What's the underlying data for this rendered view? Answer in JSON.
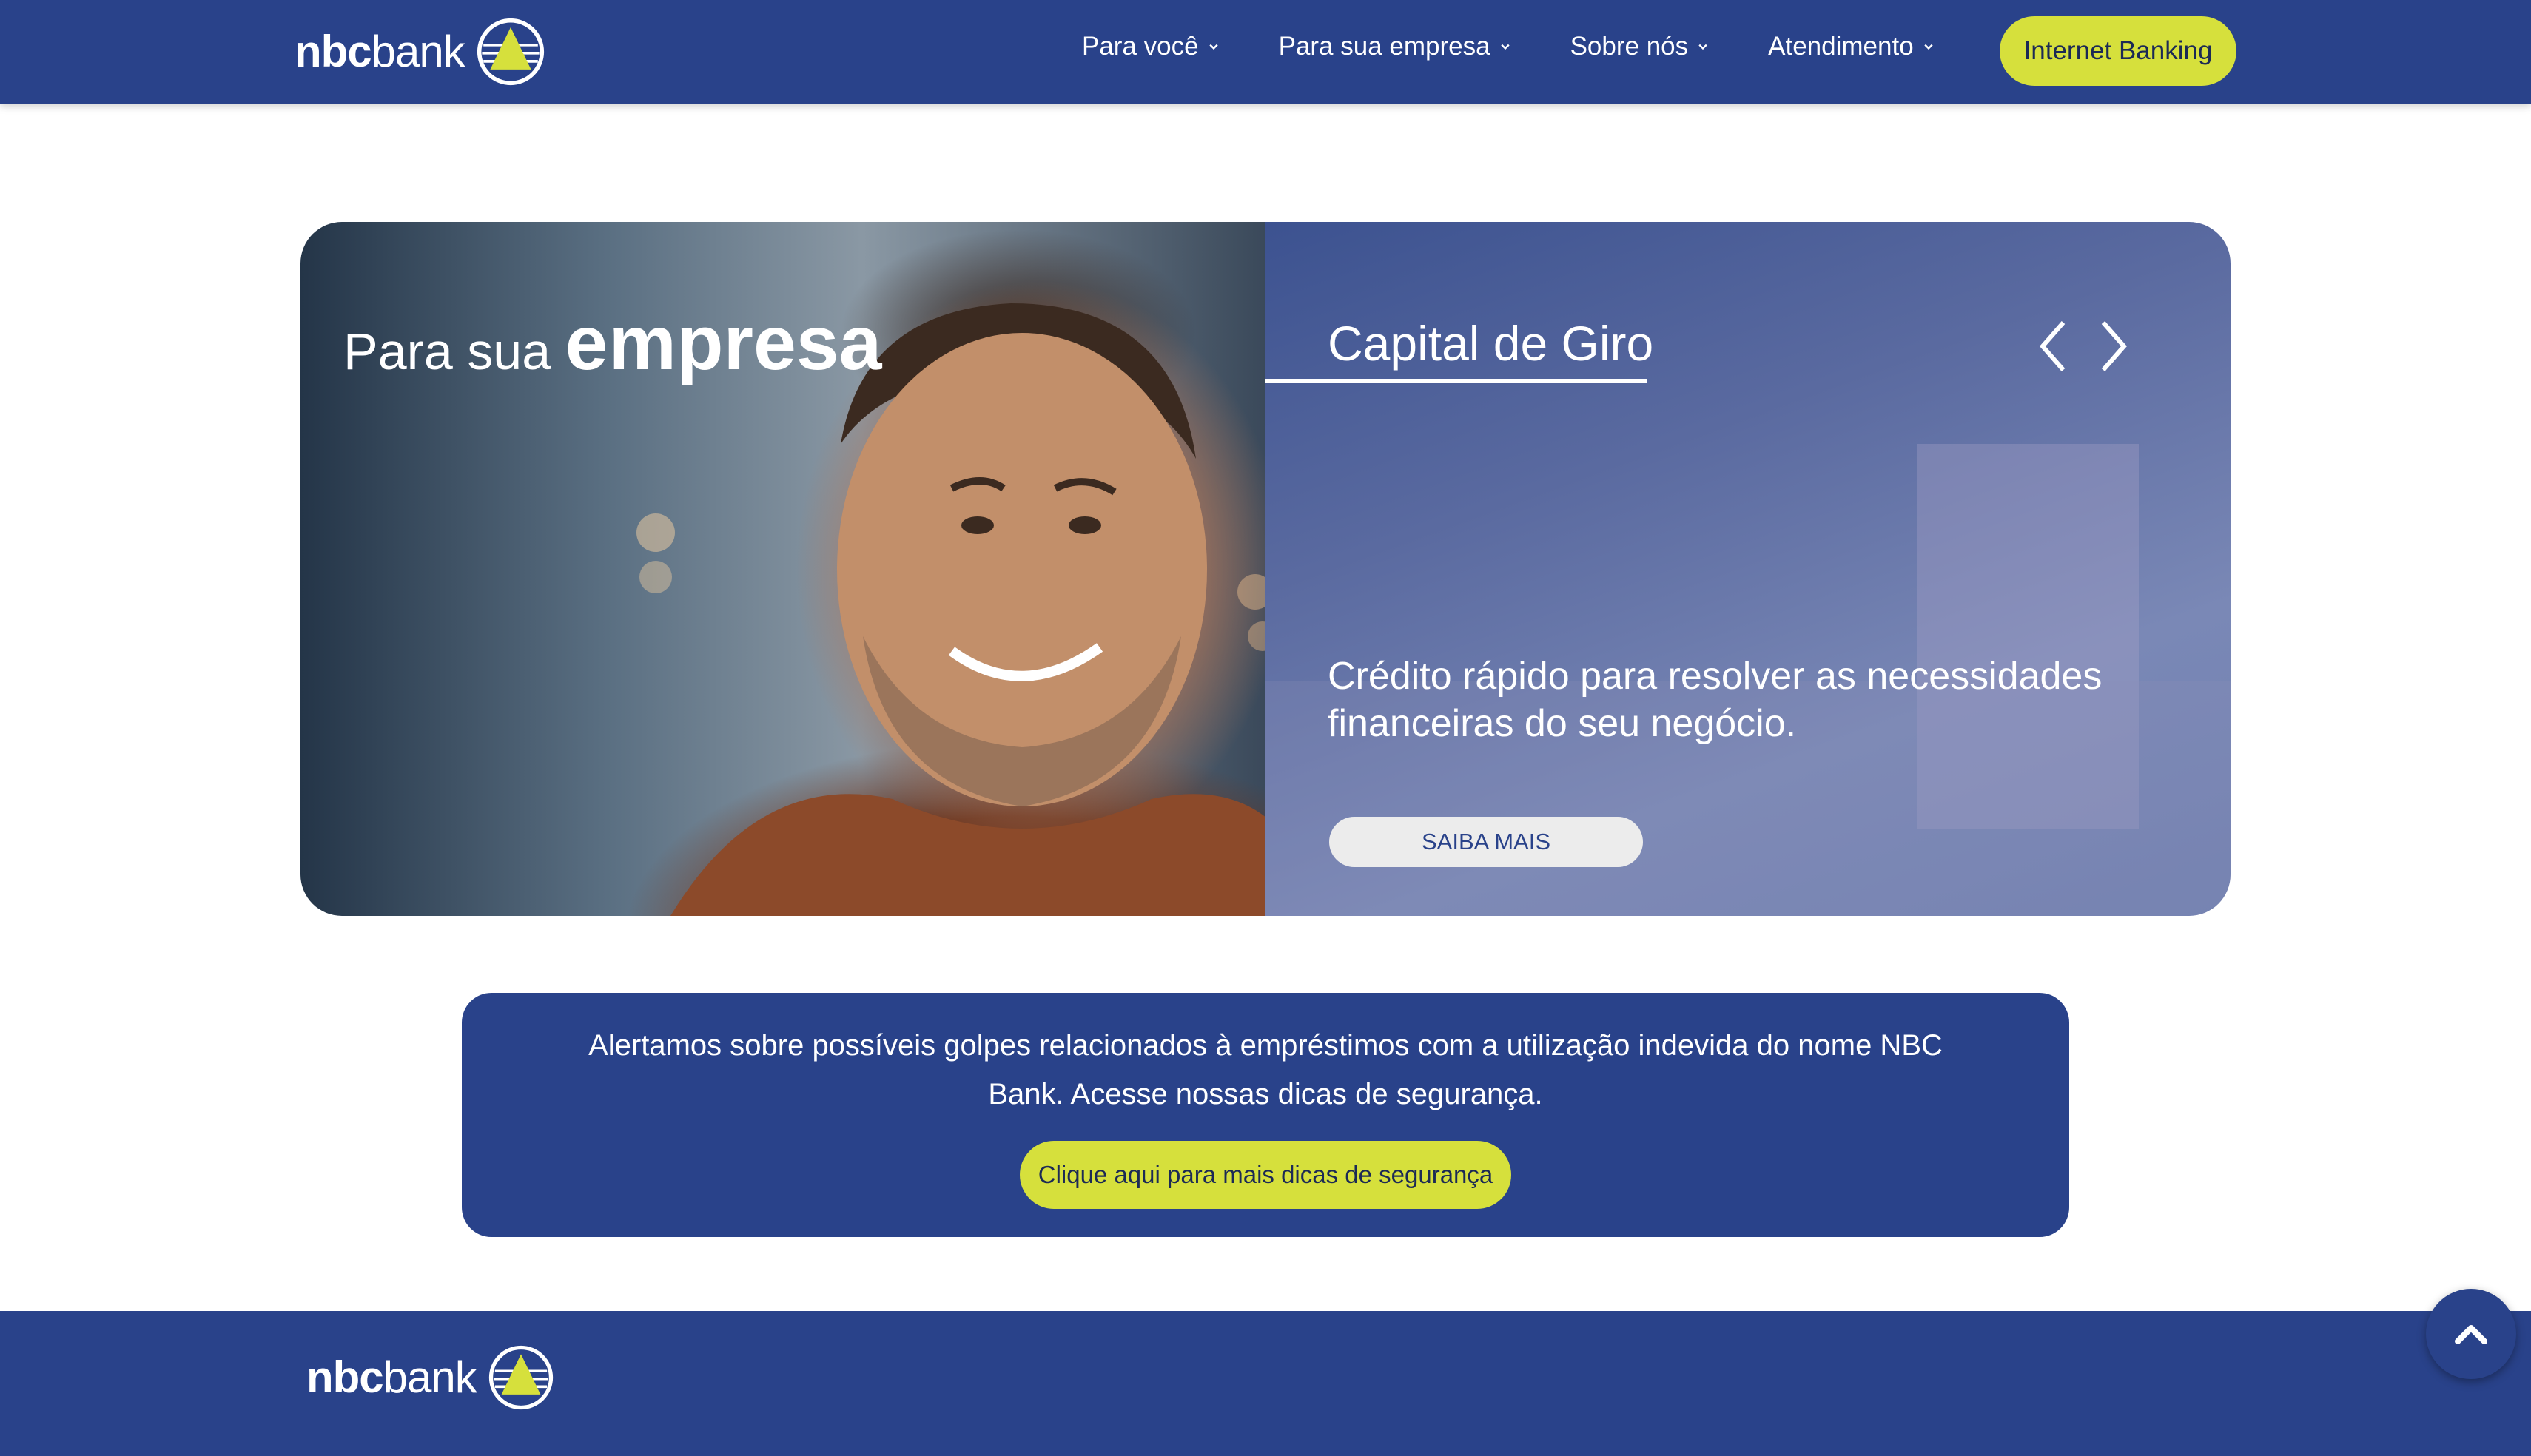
{
  "brand": {
    "logo_bold": "nbc",
    "logo_light": "bank",
    "emblem_icon": "nbc-triangle-emblem-icon"
  },
  "nav": {
    "items": [
      {
        "label": "Para você",
        "icon": "chevron-down-icon"
      },
      {
        "label": "Para sua empresa",
        "icon": "chevron-down-icon"
      },
      {
        "label": "Sobre nós",
        "icon": "chevron-down-icon"
      },
      {
        "label": "Atendimento",
        "icon": "chevron-down-icon"
      }
    ],
    "cta_label": "Internet Banking"
  },
  "hero": {
    "photo_title_prefix": "Para sua",
    "photo_title_emphasis": "empresa",
    "slide_title": "Capital de Giro",
    "slide_text": "Crédito rápido para resolver as necessidades financeiras do seu negócio.",
    "button_label": "SAIBA MAIS",
    "prev_icon": "chevron-left-icon",
    "next_icon": "chevron-right-icon"
  },
  "alert": {
    "text": "Alertamos sobre possíveis golpes relacionados à empréstimos com a utilização indevida do nome NBC Bank. Acesse nossas dicas de segurança.",
    "button_label": "Clique aqui para mais dicas de segurança"
  },
  "footer": {
    "logo_bold": "nbc",
    "logo_light": "bank"
  },
  "scroll_top_icon": "chevron-up-icon",
  "colors": {
    "primary": "#29428a",
    "accent": "#d6e03c",
    "white": "#ffffff"
  }
}
